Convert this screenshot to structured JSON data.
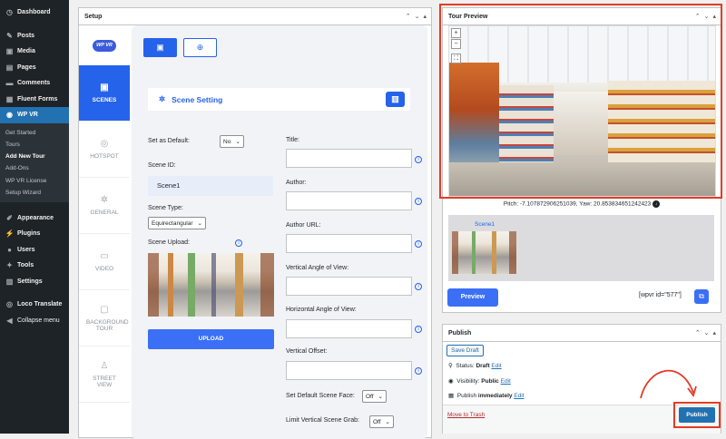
{
  "sidebar": {
    "items_top": [
      {
        "label": "Dashboard",
        "icon": "dashboard-icon"
      },
      {
        "label": "Posts",
        "icon": "pin-icon"
      },
      {
        "label": "Media",
        "icon": "media-icon"
      },
      {
        "label": "Pages",
        "icon": "page-icon"
      },
      {
        "label": "Comments",
        "icon": "comment-icon"
      },
      {
        "label": "Fluent Forms",
        "icon": "form-icon"
      },
      {
        "label": "WP VR",
        "icon": "vr-icon"
      }
    ],
    "submenu": [
      "Get Started",
      "Tours",
      "Add New Tour",
      "Add-Ons",
      "WP VR License",
      "Setup Wizard"
    ],
    "items_bottom": [
      {
        "label": "Appearance",
        "icon": "brush-icon"
      },
      {
        "label": "Plugins",
        "icon": "plugin-icon"
      },
      {
        "label": "Users",
        "icon": "users-icon"
      },
      {
        "label": "Tools",
        "icon": "wrench-icon"
      },
      {
        "label": "Settings",
        "icon": "settings-icon"
      },
      {
        "label": "Loco Translate",
        "icon": "translate-icon"
      },
      {
        "label": "Collapse menu",
        "icon": "collapse-icon"
      }
    ]
  },
  "setup": {
    "title": "Setup",
    "logo_text": "WP VR",
    "tabs": [
      "SCENES",
      "HOTSPOT",
      "GENERAL",
      "VIDEO",
      "BACKGROUND TOUR",
      "STREET VIEW"
    ],
    "scene_setting": "Scene Setting",
    "labels": {
      "set_default": "Set as Default:",
      "scene_id": "Scene ID:",
      "scene_type": "Scene Type:",
      "scene_upload": "Scene Upload:",
      "title": "Title:",
      "author": "Author:",
      "author_url": "Author URL:",
      "vertical_angle": "Vertical Angle of View:",
      "horizontal_angle": "Horizontal Angle of View:",
      "vertical_offset": "Vertical Offset:",
      "default_face": "Set Default Scene Face:",
      "limit_grab": "Limit Vertical Scene Grab:"
    },
    "values": {
      "set_default": "No",
      "scene_id": "Scene1",
      "scene_type": "Equirectangular",
      "default_face": "Off",
      "limit_grab": "Off"
    },
    "upload_label": "UPLOAD"
  },
  "tour_preview": {
    "title": "Tour Preview",
    "pitch_text": "Pitch: -7.107872906251039, Yaw: 20.853834651242423",
    "scene_label": "Scene1",
    "preview_label": "Preview",
    "shortcode": "[wpvr id=\"577\"]"
  },
  "publish": {
    "title": "Publish",
    "save_draft": "Save Draft",
    "status_label": "Status:",
    "status_value": "Draft",
    "visibility_label": "Visibility:",
    "visibility_value": "Public",
    "publish_label": "Publish",
    "publish_value": "immediately",
    "edit": "Edit",
    "trash": "Move to Trash",
    "publish_button": "Publish"
  },
  "colors": {
    "accent": "#2563eb",
    "highlight": "#e23b26",
    "wp_blue": "#2271b1"
  }
}
